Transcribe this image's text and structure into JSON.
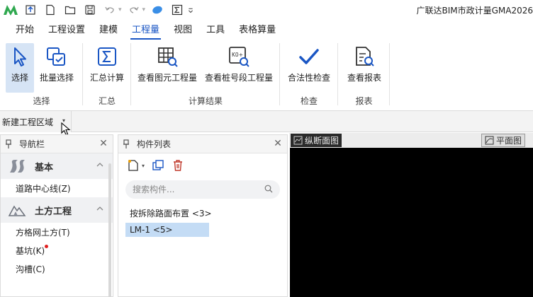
{
  "app": {
    "title": "广联达BIM市政计量GMA2026"
  },
  "menu": {
    "tabs": [
      {
        "label": "开始"
      },
      {
        "label": "工程设置"
      },
      {
        "label": "建模"
      },
      {
        "label": "工程量"
      },
      {
        "label": "视图"
      },
      {
        "label": "工具"
      },
      {
        "label": "表格算量"
      }
    ],
    "active": "工程量"
  },
  "ribbon": {
    "groups": [
      {
        "label": "选择",
        "buttons": [
          {
            "label": "选择"
          },
          {
            "label": "批量选择"
          }
        ]
      },
      {
        "label": "汇总",
        "buttons": [
          {
            "label": "汇总计算"
          }
        ]
      },
      {
        "label": "计算结果",
        "buttons": [
          {
            "label": "查看图元工程量"
          },
          {
            "label": "查看桩号段工程量"
          }
        ]
      },
      {
        "label": "检查",
        "buttons": [
          {
            "label": "合法性检查"
          }
        ]
      },
      {
        "label": "报表",
        "buttons": [
          {
            "label": "查看报表"
          }
        ]
      }
    ],
    "icon_k0": "K0+"
  },
  "region": {
    "value": "新建工程区域"
  },
  "nav_panel": {
    "title": "导航栏",
    "sections": [
      {
        "label": "基本",
        "items": [
          {
            "label": "道路中心线(Z)"
          }
        ]
      },
      {
        "label": "土方工程",
        "items": [
          {
            "label": "方格网土方(T)"
          },
          {
            "label": "基坑(K)"
          },
          {
            "label": "沟槽(C)"
          }
        ]
      }
    ]
  },
  "component_panel": {
    "title": "构件列表",
    "search_placeholder": "搜索构件...",
    "items": [
      {
        "label": "按拆除路面布置 <3>"
      },
      {
        "label": "LM-1 <5>"
      }
    ]
  },
  "canvas": {
    "tabs": [
      {
        "label": "纵断面图"
      },
      {
        "label": "平面图"
      }
    ]
  },
  "colors": {
    "accent": "#1a56c4",
    "selected_bg": "#d6e4f5",
    "logo_green": "#2fa84f"
  }
}
